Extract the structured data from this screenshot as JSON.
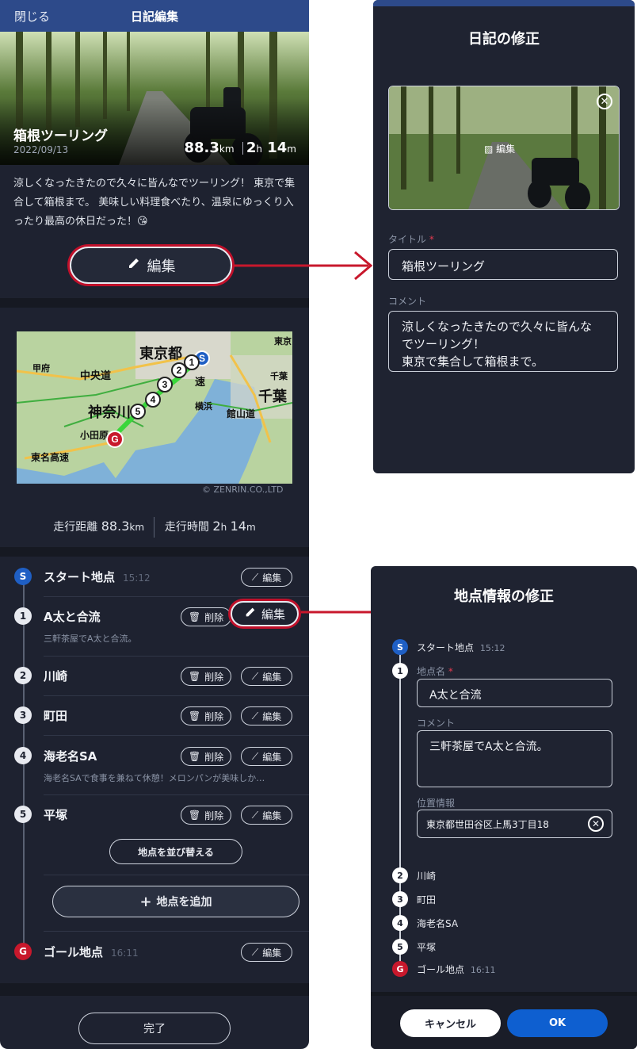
{
  "left": {
    "header": {
      "close": "閉じる",
      "title": "日記編集"
    },
    "hero": {
      "title": "箱根ツーリング",
      "date": "2022/09/13",
      "distance": "88.3",
      "distance_unit": "km",
      "hours": "2",
      "hours_unit": "h",
      "minutes": "14",
      "minutes_unit": "m"
    },
    "description": "涼しくなったきたので久々に皆んなでツーリング！ 東京で集合して箱根まで。 美味しい料理食べたり、温泉にゆっくり入ったり最高の休日だった！😘",
    "edit_button": "編集",
    "map": {
      "copyright": "© ZENRIN.CO.,LTD",
      "labels": [
        "東京都",
        "甲府",
        "中央道",
        "神奈川",
        "千葉",
        "横浜",
        "館山道",
        "小田原",
        "東名高速",
        "東京",
        "千葉",
        "速"
      ]
    },
    "stats": {
      "distance_label": "走行距離",
      "distance": "88.3",
      "distance_unit": "km",
      "time_label": "走行時間",
      "hours": "2",
      "hours_unit": "h",
      "minutes": "14",
      "minutes_unit": "m"
    },
    "waypoints": [
      {
        "badge": "S",
        "name": "スタート地点",
        "time": "15:12",
        "note": "",
        "delete": "",
        "edit": "編集"
      },
      {
        "badge": "1",
        "name": "A太と合流",
        "time": "",
        "note": "三軒茶屋でA太と合流。",
        "delete": "削除",
        "edit": "編集"
      },
      {
        "badge": "2",
        "name": "川崎",
        "time": "",
        "note": "",
        "delete": "削除",
        "edit": "編集"
      },
      {
        "badge": "3",
        "name": "町田",
        "time": "",
        "note": "",
        "delete": "削除",
        "edit": "編集"
      },
      {
        "badge": "4",
        "name": "海老名SA",
        "time": "",
        "note": "海老名SAで食事を兼ねて休憩！メロンパンが美味しか…",
        "delete": "削除",
        "edit": "編集"
      },
      {
        "badge": "5",
        "name": "平塚",
        "time": "",
        "note": "",
        "delete": "削除",
        "edit": "編集"
      }
    ],
    "reorder_button": "地点を並び替える",
    "add_button": "地点を追加",
    "goal": {
      "badge": "G",
      "name": "ゴール地点",
      "time": "16:11",
      "edit": "編集"
    },
    "done_button": "完了"
  },
  "panel1": {
    "title": "日記の修正",
    "photo_edit": "編集",
    "title_label": "タイトル",
    "required": "*",
    "title_value": "箱根ツーリング",
    "comment_label": "コメント",
    "comment_lines": [
      "涼しくなったきたので久々に皆んな",
      "でツーリング！",
      "東京で集合して箱根まで。"
    ]
  },
  "panel2": {
    "title": "地点情報の修正",
    "start": {
      "badge": "S",
      "name": "スタート地点",
      "time": "15:12"
    },
    "current": {
      "badge": "1",
      "name_label": "地点名",
      "required": "*",
      "name_value": "A太と合流",
      "comment_label": "コメント",
      "comment_value": "三軒茶屋でA太と合流。",
      "location_label": "位置情報",
      "location_value": "東京都世田谷区上馬3丁目18"
    },
    "others": [
      {
        "badge": "2",
        "name": "川崎"
      },
      {
        "badge": "3",
        "name": "町田"
      },
      {
        "badge": "4",
        "name": "海老名SA"
      },
      {
        "badge": "5",
        "name": "平塚"
      }
    ],
    "goal": {
      "badge": "G",
      "name": "ゴール地点",
      "time": "16:11"
    },
    "cancel": "キャンセル",
    "ok": "OK"
  },
  "colors": {
    "bg_dark": "#1e2230",
    "header_blue": "#2d4a8a",
    "accent_red": "#c8182c",
    "start_blue": "#1f5fc4",
    "ok_blue": "#0e5fd0"
  }
}
